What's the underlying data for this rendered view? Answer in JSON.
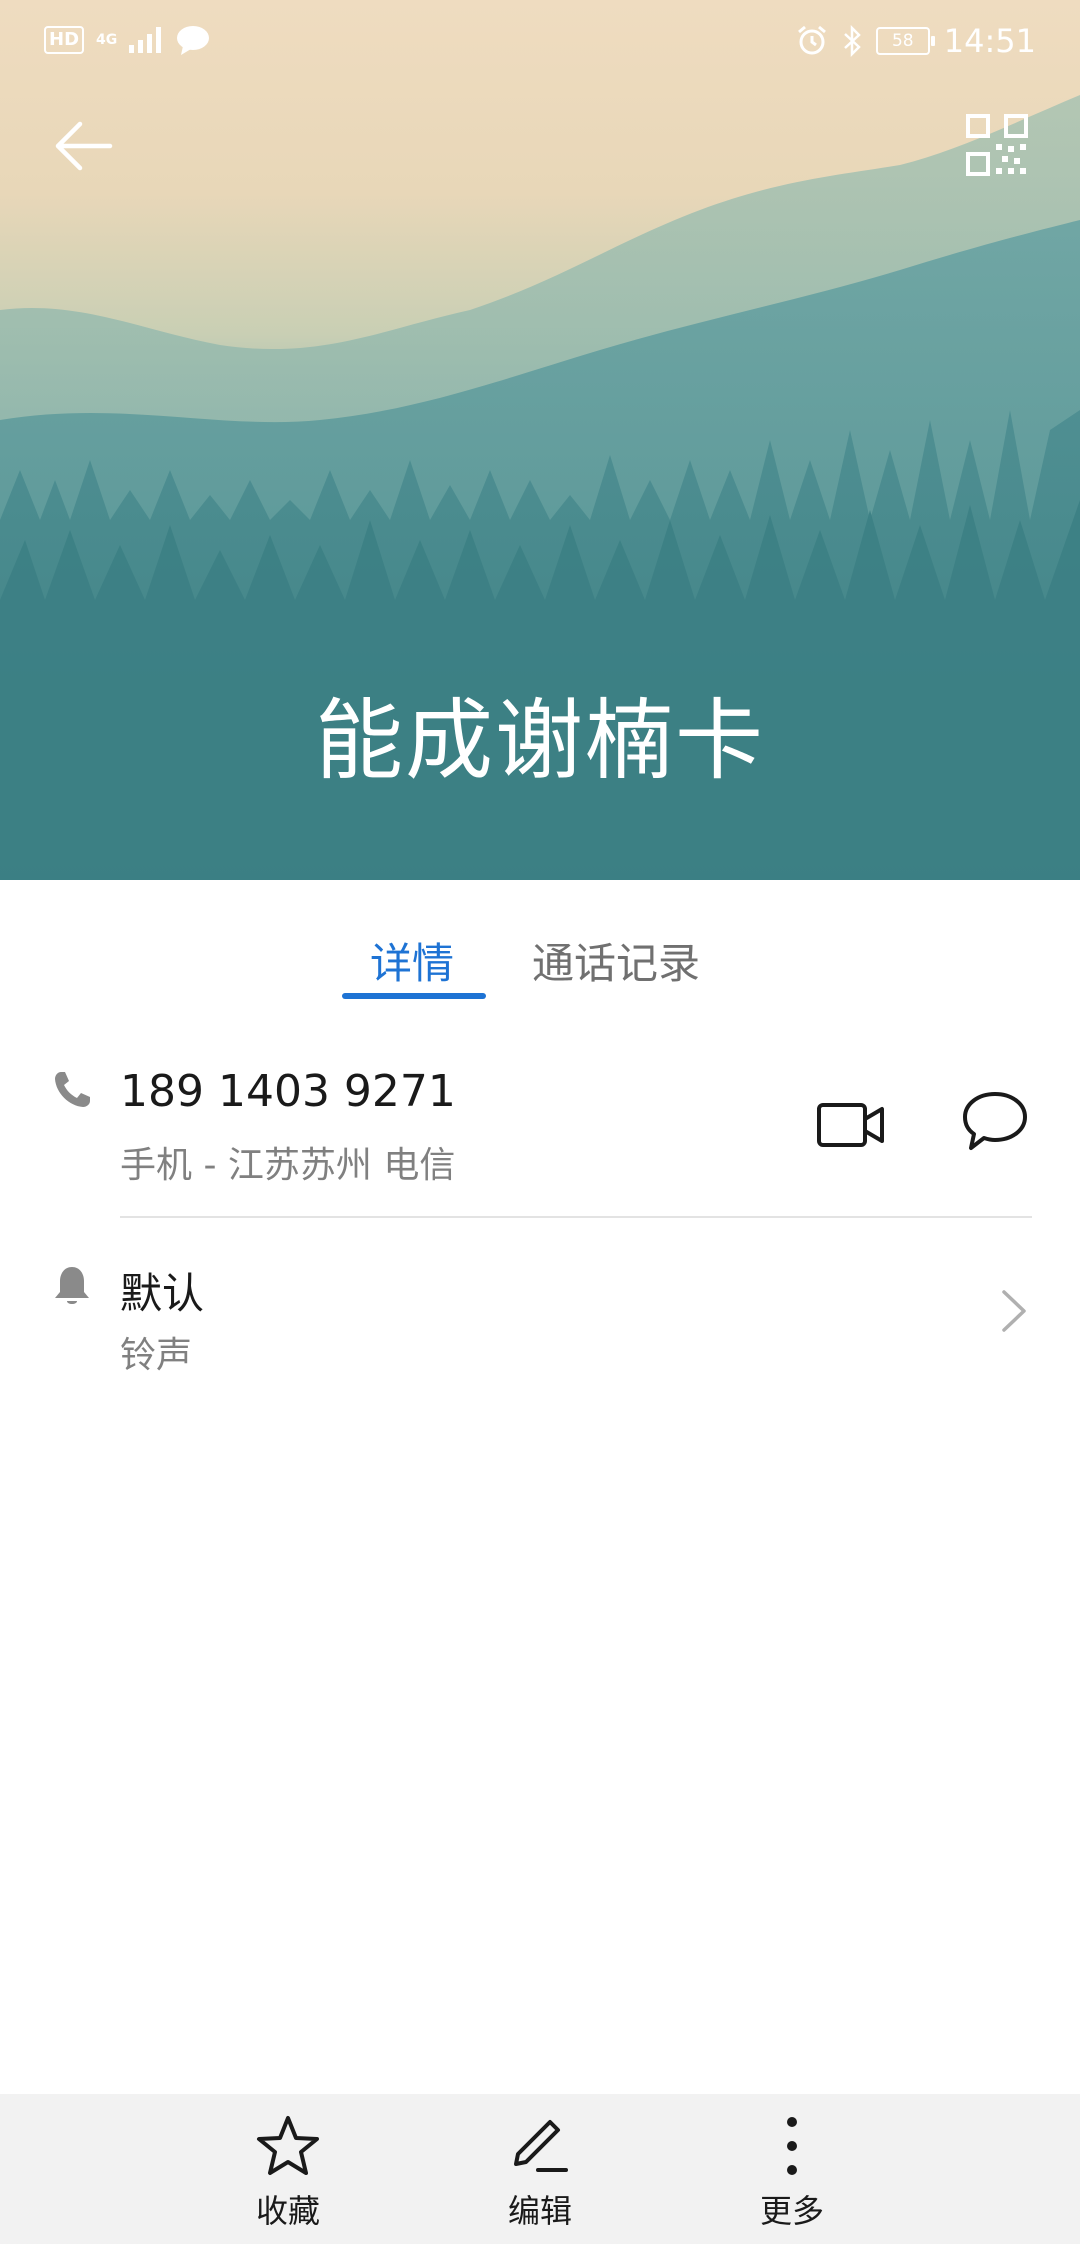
{
  "status_bar": {
    "hd_badge": "HD",
    "network": "4G",
    "battery": "58",
    "time": "14:51"
  },
  "contact": {
    "name": "能成谢楠卡"
  },
  "tabs": [
    {
      "label": "详情",
      "active": true
    },
    {
      "label": "通话记录",
      "active": false
    }
  ],
  "phone": {
    "number": "189 1403 9271",
    "detail": "手机 - 江苏苏州 电信"
  },
  "ringtone": {
    "title": "默认",
    "subtitle": "铃声"
  },
  "bottom_bar": {
    "favorite_label": "收藏",
    "edit_label": "编辑",
    "more_label": "更多"
  },
  "colors": {
    "accent": "#1e73d4",
    "secondary_text": "#808080",
    "bottom_bar_bg": "#f2f2f2"
  }
}
